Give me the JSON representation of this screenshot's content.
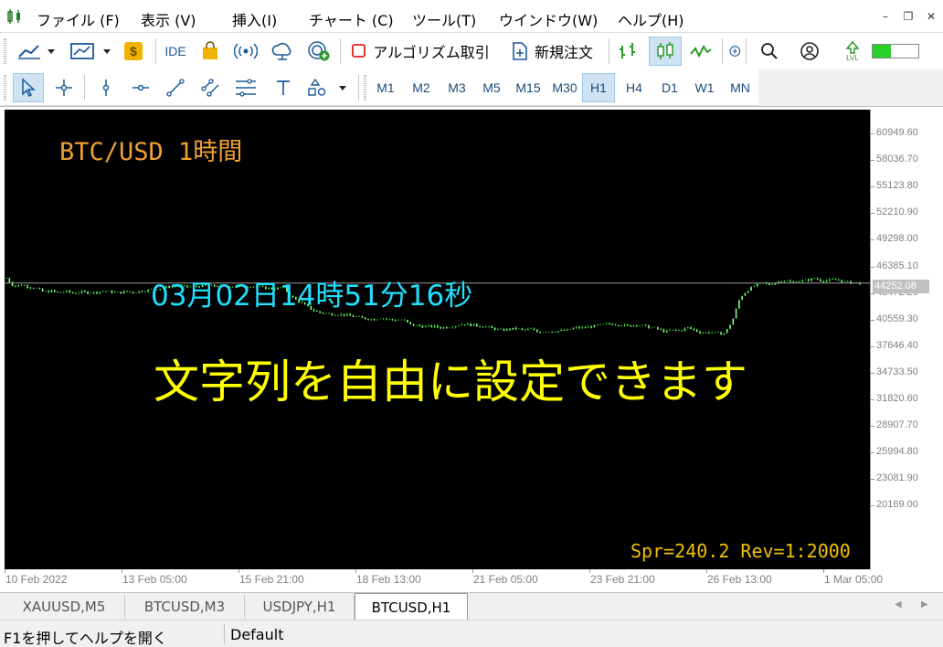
{
  "menu": [
    {
      "label": "ファイル (F)"
    },
    {
      "label": "表示 (V)"
    },
    {
      "label": "挿入(I)"
    },
    {
      "label": "チャート (C)"
    },
    {
      "label": "ツール(T)"
    },
    {
      "label": "ウインドウ(W)"
    },
    {
      "label": "ヘルプ(H)"
    }
  ],
  "window_controls": {
    "minimize": "–",
    "restore": "❐",
    "close": "✕"
  },
  "toolbar": {
    "ide_label": "IDE",
    "algo_label": "アルゴリズム取引",
    "new_order_label": "新規注文",
    "lvl_label": "LVL"
  },
  "timeframes": [
    "M1",
    "M2",
    "M3",
    "M5",
    "M15",
    "M30",
    "H1",
    "H4",
    "D1",
    "W1",
    "MN"
  ],
  "active_timeframe": "H1",
  "chart": {
    "overlay_title": "BTC/USD 1時間",
    "overlay_time": "03月02日14時51分16秒",
    "overlay_message": "文字列を自由に設定できます",
    "overlay_spread": "Spr=240.2 Rev=1:2000",
    "current_price": "44252.08",
    "price_labels": [
      "60949.60",
      "58036.70",
      "55123.80",
      "52210.90",
      "49298.00",
      "46385.10",
      "43472.20",
      "40559.30",
      "37646.40",
      "34733.50",
      "31820.60",
      "28907.70",
      "25994.80",
      "23081.90",
      "20169.00"
    ],
    "time_labels": [
      "10 Feb 2022",
      "13 Feb 05:00",
      "15 Feb 21:00",
      "18 Feb 13:00",
      "21 Feb 05:00",
      "23 Feb 21:00",
      "26 Feb 13:00",
      "1 Mar 05:00"
    ],
    "colors": {
      "background": "#000000",
      "candles": "#00c000",
      "overlay_title": "#f0a030",
      "overlay_time": "#20e0ff",
      "overlay_message": "#ffff00"
    }
  },
  "chart_tabs": [
    {
      "label": "XAUUSD,M5"
    },
    {
      "label": "BTCUSD,M3"
    },
    {
      "label": "USDJPY,H1"
    },
    {
      "label": "BTCUSD,H1"
    }
  ],
  "active_tab": "BTCUSD,H1",
  "status": {
    "help": "F1を押してヘルプを開く",
    "profile": "Default"
  },
  "series": {
    "name": "",
    "close_prices": [
      44800,
      43900,
      44100,
      43850,
      43700,
      43300,
      43400,
      43200,
      43350,
      43150,
      43300,
      43200,
      43250,
      43400,
      43300,
      43200,
      43350,
      43250,
      43400,
      43500,
      43600,
      43800,
      43900,
      43950,
      43850,
      43900,
      43950,
      43980,
      43950,
      43900,
      43920,
      43850,
      43900,
      43950,
      43800,
      43700,
      43650,
      43900,
      42800,
      42300,
      41800,
      41300,
      41000,
      40900,
      40850,
      40800,
      40700,
      40500,
      40400,
      40300,
      40450,
      40300,
      40200,
      40250,
      39700,
      39600,
      39500,
      39550,
      39400,
      39450,
      39600,
      39800,
      39700,
      39600,
      39500,
      39300,
      39100,
      39200,
      39300,
      39100,
      39250,
      38900,
      39000,
      38950,
      39050,
      39100,
      39400,
      39350,
      39500,
      39600,
      39750,
      39800,
      39700,
      39550,
      39700,
      39600,
      39400,
      39250,
      38950,
      39100,
      39050,
      39400,
      39100,
      38800,
      38900,
      38750,
      38800,
      40200,
      42700,
      43500,
      44000,
      44300,
      44100,
      44400,
      44600,
      44300,
      44500,
      44600,
      44800,
      44500,
      44600,
      44650,
      44400,
      44300,
      44252
    ]
  }
}
